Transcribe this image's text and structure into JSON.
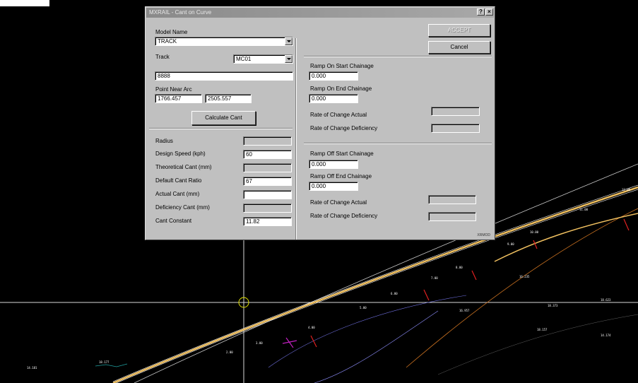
{
  "dialog": {
    "title": "MXRAIL - Cant on Curve",
    "help_glyph": "?",
    "close_glyph": "×",
    "model_name_label": "Model Name",
    "model_name_value": "TRACK",
    "track_label": "Track",
    "track_value": "MC01",
    "track_text_value": "8888",
    "point_near_arc_label": "Point Near Arc",
    "point_x": "1766.457",
    "point_y": "2505.557",
    "calculate_button": "Calculate Cant",
    "ok_button": "ACCEPT",
    "cancel_button": "Cancel",
    "ramp_on_start_label": "Ramp On Start Chainage",
    "ramp_on_start_value": "0.000",
    "ramp_on_end_label": "Ramp On End Chainage",
    "ramp_on_end_value": "0.000",
    "roc_actual_on_label": "Rate of Change Actual",
    "roc_deficiency_on_label": "Rate of Change Deficiency",
    "ramp_off_start_label": "Ramp Off Start Chainage",
    "ramp_off_start_value": "0.000",
    "ramp_off_end_label": "Ramp Off End Chainage",
    "ramp_off_end_value": "0.000",
    "roc_actual_off_label": "Rate of Change Actual",
    "roc_deficiency_off_label": "Rate of Change Deficiency",
    "radius_label": "Radius",
    "design_speed_label": "Design Speed (kph)",
    "design_speed_value": "60",
    "theoretical_cant_label": "Theoretical Cant (mm)",
    "default_cant_ratio_label": "Default Cant Ratio",
    "default_cant_ratio_value": "67",
    "actual_cant_label": "Actual Cant (mm)",
    "deficiency_cant_label": "Deficiency Cant (mm)",
    "cant_constant_label": "Cant Constant",
    "cant_constant_value": "11.82",
    "status_text": "XRMOD"
  },
  "drawing": {
    "background": "#000000",
    "crosshair_color": "#e8e8e8",
    "track_color": "#f0c060",
    "label_color": "#ffffff",
    "chainage_labels": [
      "2.00",
      "3.00",
      "4.00",
      "5.00",
      "6.00",
      "7.00",
      "8.00",
      "9.00",
      "10.00",
      "11.00",
      "12.00"
    ],
    "point_labels": [
      "14.181",
      "18.177",
      "16.957",
      "18.373",
      "18.157",
      "18.623",
      "14.174",
      "16.235"
    ]
  }
}
